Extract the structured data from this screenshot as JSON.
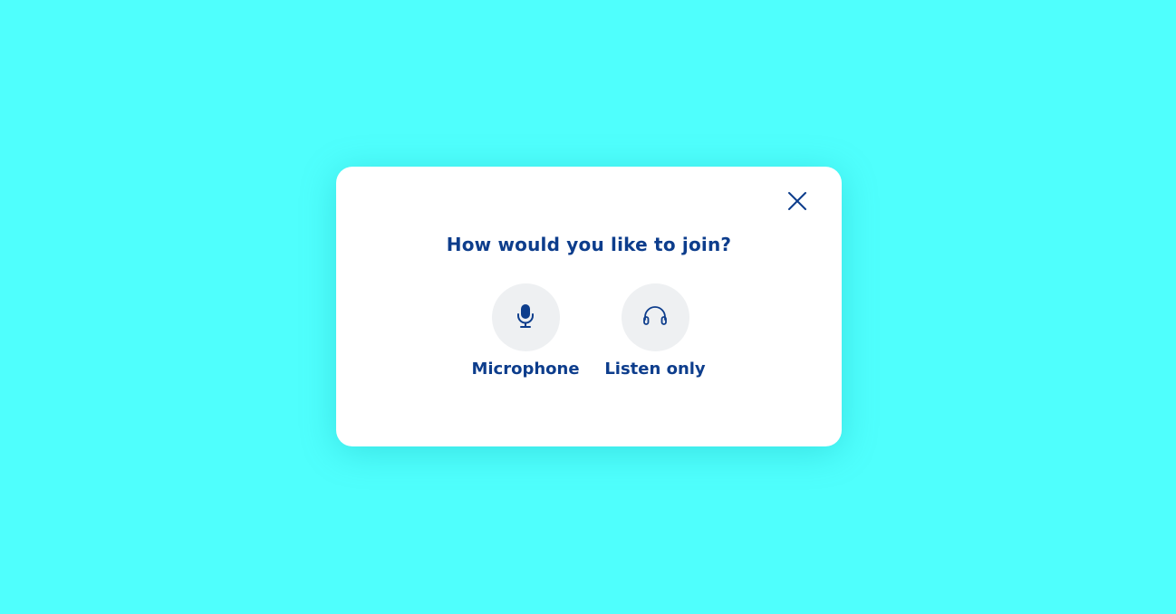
{
  "dialog": {
    "title": "How would you like to join?",
    "close_icon": "close-icon",
    "options": [
      {
        "label": "Microphone",
        "icon": "microphone-icon"
      },
      {
        "label": "Listen only",
        "icon": "headphones-icon"
      }
    ]
  },
  "colors": {
    "backdrop": "#4ffffd",
    "dialog_bg": "#ffffff",
    "text_primary": "#0d3d8c",
    "option_circle_bg": "#eef0f2"
  }
}
